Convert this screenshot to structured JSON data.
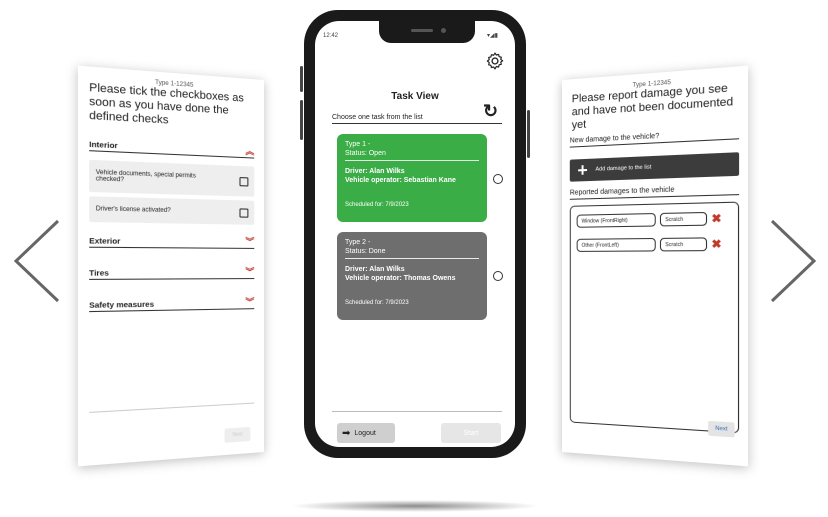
{
  "colors": {
    "green": "#3bad46",
    "grey": "#6e6e6e",
    "red": "#c0392b",
    "dark": "#3c3c3c"
  },
  "left_screen": {
    "type_label": "Type 1-12345",
    "heading": "Please tick the checkboxes as soon as you have done the defined checks",
    "sections": {
      "interior": "Interior",
      "exterior": "Exterior",
      "tires": "Tires",
      "safety": "Safety measures"
    },
    "checks": [
      "Vehicle documents, special permits checked?",
      "Driver's license activated?"
    ],
    "next_label": "Next"
  },
  "phone": {
    "status_time": "12:42",
    "title": "Task View",
    "subtitle": "Choose one task from the list",
    "tasks": [
      {
        "type": "Type 1 -",
        "status": "Status: Open",
        "driver": "Driver: Alan Wilks",
        "operator": "Vehicle operator: Sebastian Kane",
        "scheduled": "Scheduled for: 7/9/2023"
      },
      {
        "type": "Type 2 -",
        "status": "Status: Done",
        "driver": "Driver: Alan Wilks",
        "operator": "Vehicle operator: Thomas Owens",
        "scheduled": "Scheduled for: 7/9/2023"
      }
    ],
    "logout_label": "Logout",
    "start_label": "Start"
  },
  "right_screen": {
    "type_label": "Type 1-12345",
    "heading": "Please report damage you see and have not been documented yet",
    "new_damage_label": "New damage to the vehicle?",
    "add_damage_label": "Add damage to the list",
    "reported_label": "Reported damages to the vehicle",
    "damages": [
      {
        "location": "Window (FrontRight)",
        "kind": "Scratch"
      },
      {
        "location": "Other (FrontLeft)",
        "kind": "Scratch"
      }
    ],
    "next_label": "Next"
  }
}
